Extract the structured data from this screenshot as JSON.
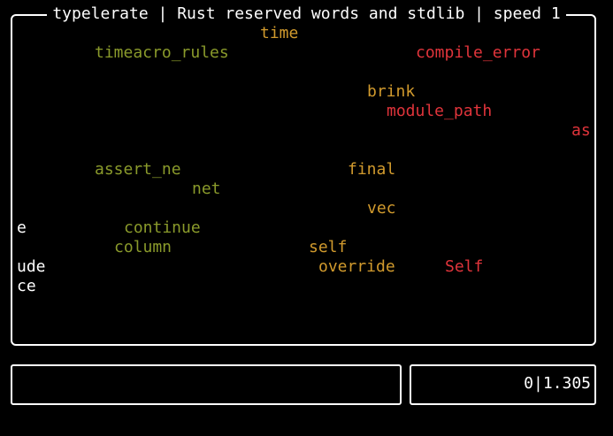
{
  "app": {
    "title": "typelerate | Rust reserved words and stdlib | speed 1"
  },
  "colors": {
    "background": "#000000",
    "border": "#ffffff",
    "green": "#8a9a2b",
    "orange": "#d19a2d",
    "red": "#e0343b",
    "white": "#ffffff"
  },
  "words": [
    {
      "text": "time",
      "color": "orange"
    },
    {
      "text": "timeacro_rules",
      "color": "green"
    },
    {
      "text": "compile_error",
      "color": "red"
    },
    {
      "text": "brink",
      "color": "orange"
    },
    {
      "text": "module_path",
      "color": "red"
    },
    {
      "text": "as",
      "color": "red"
    },
    {
      "text": "assert_ne",
      "color": "green"
    },
    {
      "text": "final",
      "color": "orange"
    },
    {
      "text": "net",
      "color": "green"
    },
    {
      "text": "vec",
      "color": "orange"
    },
    {
      "text": "e",
      "color": "white"
    },
    {
      "text": "continue",
      "color": "green"
    },
    {
      "text": "column",
      "color": "green"
    },
    {
      "text": "self",
      "color": "orange"
    },
    {
      "text": "ude",
      "color": "white"
    },
    {
      "text": "override",
      "color": "orange"
    },
    {
      "text": "Self",
      "color": "red"
    },
    {
      "text": "ce",
      "color": "white"
    }
  ],
  "input": {
    "value": ""
  },
  "status": {
    "score": "0|1.305"
  }
}
